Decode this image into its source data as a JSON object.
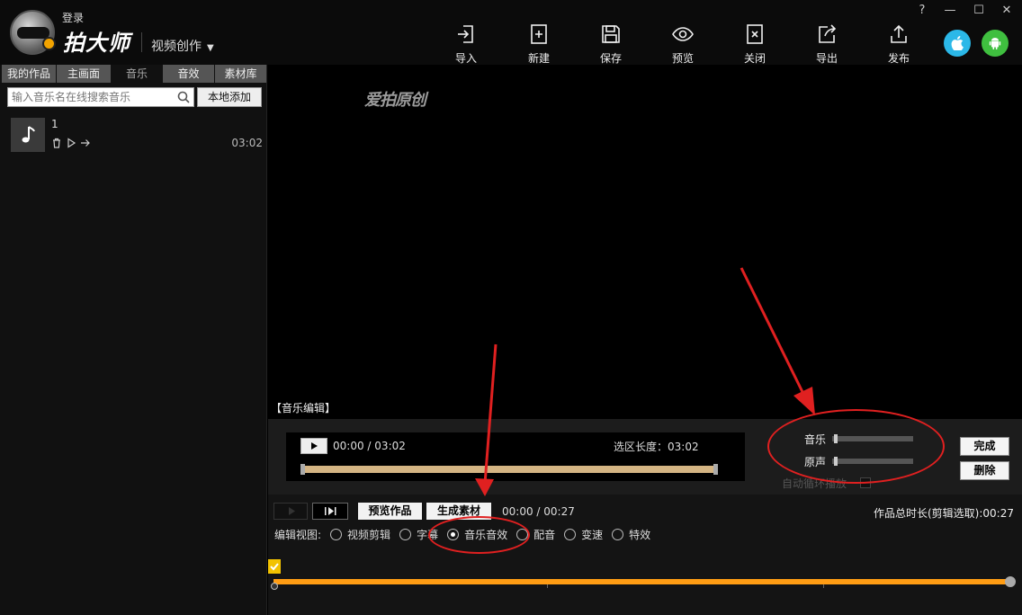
{
  "header": {
    "login": "登录",
    "brand": "拍大师",
    "mode": "视频创作",
    "toolbar": [
      {
        "label": "导入",
        "icon": "import-icon"
      },
      {
        "label": "新建",
        "icon": "new-icon"
      },
      {
        "label": "保存",
        "icon": "save-icon"
      },
      {
        "label": "预览",
        "icon": "preview-eye-icon"
      },
      {
        "label": "关闭",
        "icon": "close-doc-icon"
      },
      {
        "label": "导出",
        "icon": "export-icon"
      },
      {
        "label": "发布",
        "icon": "publish-icon"
      }
    ],
    "window_controls": [
      "?",
      "—",
      "☐",
      "✕"
    ],
    "colors": {
      "apple": "#2bb8e8",
      "android": "#3fbf3f",
      "accent": "#ff9d14",
      "annotation": "#e02020"
    }
  },
  "left": {
    "tabs": [
      "我的作品",
      "主画面",
      "音乐",
      "音效",
      "素材库"
    ],
    "search_placeholder": "输入音乐名在线搜索音乐",
    "add_local": "本地添加",
    "track": {
      "name": "1",
      "duration": "03:02"
    }
  },
  "preview": {
    "watermark": "爱拍原创"
  },
  "music_edit": {
    "title": "【音乐编辑】",
    "current": "00:00",
    "slash": "/",
    "total": "03:02",
    "selection_label": "选区长度：",
    "selection": "03:02",
    "music_label": "音乐",
    "voice_label": "原声",
    "music_volume": 0.02,
    "voice_volume": 0.02,
    "loop_label": "自动循环播放",
    "done": "完成",
    "delete": "删除"
  },
  "bottom": {
    "preview_work": "预览作品",
    "generate": "生成素材",
    "time": "00:00 / 00:27",
    "total_duration": "作品总时长(剪辑选取):00:27",
    "view_label": "编辑视图:",
    "views": [
      "视频剪辑",
      "字幕",
      "音乐音效",
      "配音",
      "变速",
      "特效"
    ],
    "selected_view": "音乐音效"
  }
}
